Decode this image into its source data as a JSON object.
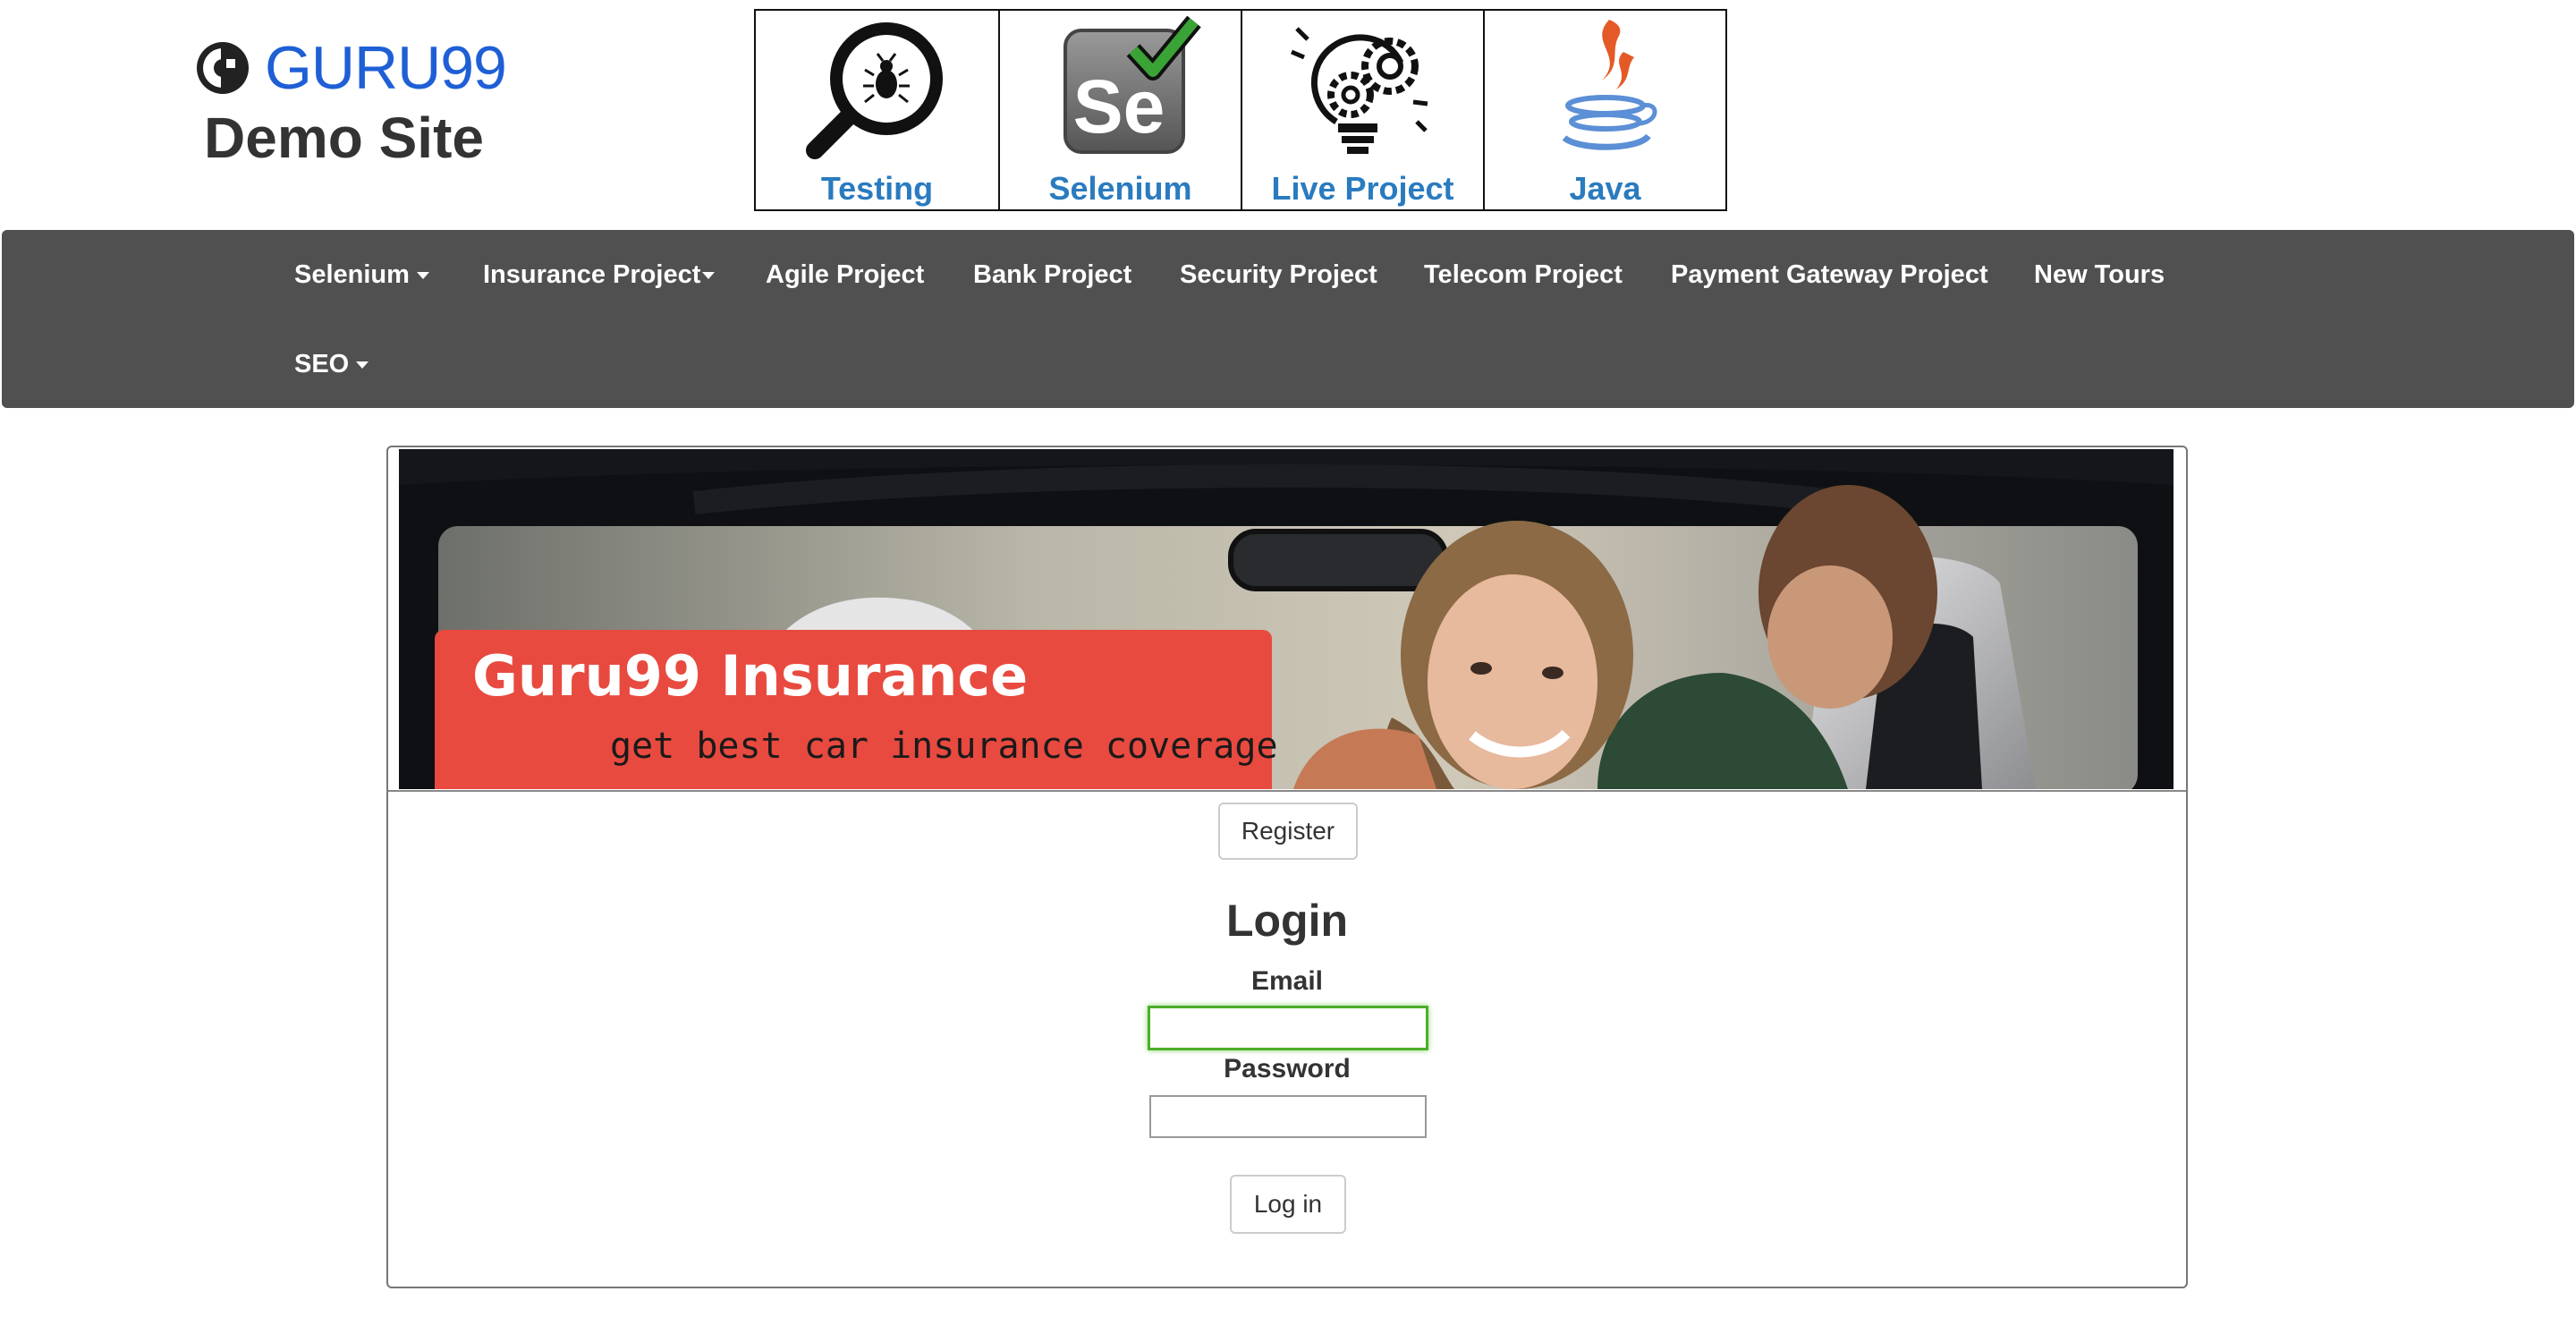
{
  "header": {
    "logo_text": "GURU99",
    "site_subtitle": "Demo Site"
  },
  "tiles": [
    {
      "label": "Testing",
      "icon": "magnifier-bug-icon"
    },
    {
      "label": "Selenium",
      "icon": "selenium-icon"
    },
    {
      "label": "Live Project",
      "icon": "lightbulb-gears-icon"
    },
    {
      "label": "Java",
      "icon": "java-icon"
    }
  ],
  "nav": {
    "items": [
      {
        "label": "Selenium",
        "dropdown": true
      },
      {
        "label": "Insurance Project",
        "dropdown": true
      },
      {
        "label": "Agile Project",
        "dropdown": false
      },
      {
        "label": "Bank Project",
        "dropdown": false
      },
      {
        "label": "Security Project",
        "dropdown": false
      },
      {
        "label": "Telecom Project",
        "dropdown": false
      },
      {
        "label": "Payment Gateway Project",
        "dropdown": false
      },
      {
        "label": "New Tours",
        "dropdown": false
      },
      {
        "label": "SEO",
        "dropdown": true
      }
    ],
    "background": "#505050"
  },
  "banner": {
    "title": "Guru99 Insurance",
    "tagline": "get best car insurance coverage",
    "accent": "#e84a3f"
  },
  "main": {
    "register_label": "Register",
    "login_heading": "Login",
    "email_label": "Email",
    "email_value": "",
    "password_label": "Password",
    "password_value": "",
    "login_button": "Log in"
  },
  "colors": {
    "link_blue": "#2a7bbf",
    "logo_blue": "#1f5fd6",
    "focus_green": "#4caf2a"
  }
}
